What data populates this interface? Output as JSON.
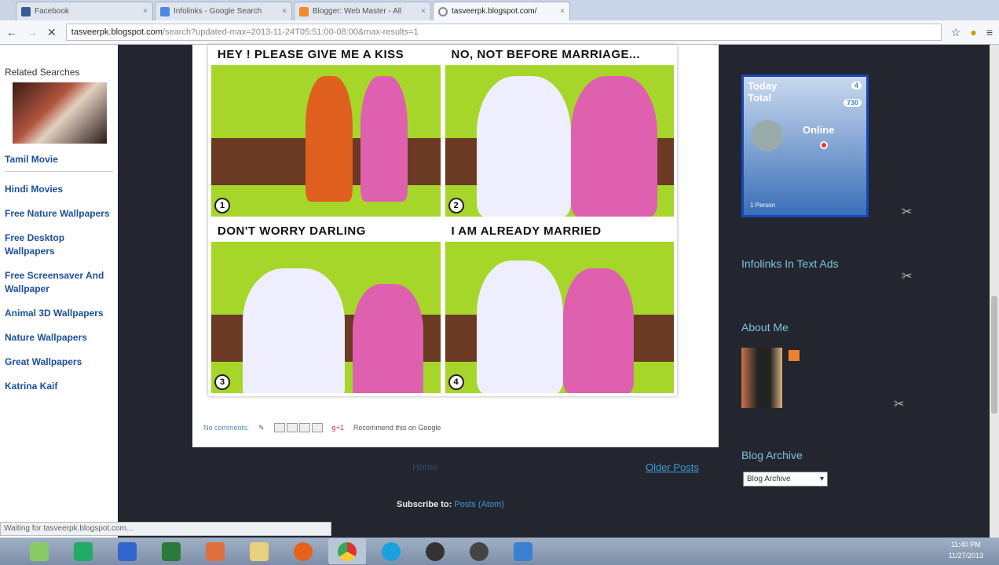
{
  "browser": {
    "tabs": [
      {
        "label": "Facebook",
        "color": "#3b5998"
      },
      {
        "label": "Infolinks - Google Search",
        "color": "#4a8ae0"
      },
      {
        "label": "Blogger: Web Master - All",
        "color": "#f28a2a"
      },
      {
        "label": "tasveerpk.blogspot.com/",
        "color": "#888"
      }
    ],
    "url_host": "tasveerpk.blogspot.com",
    "url_path": "/search?updated-max=2013-11-24T05:51:00-08:00&max-results=1"
  },
  "left": {
    "title": "Related Searches",
    "links": [
      "Tamil Movie",
      "Hindi Movies",
      "Free Nature Wallpapers",
      "Free Desktop Wallpapers",
      "Free Screensaver And Wallpaper",
      "Animal 3D Wallpapers",
      "Nature Wallpapers",
      "Great Wallpapers",
      "Katrina Kaif"
    ]
  },
  "comic": {
    "panels": [
      {
        "caption": "HEY ! PLEASE GIVE ME A KISS",
        "num": "1"
      },
      {
        "caption": "NO, NOT BEFORE MARRIAGE...",
        "num": "2"
      },
      {
        "caption": "DON'T WORRY DARLING",
        "num": "3"
      },
      {
        "caption": "I AM ALREADY MARRIED",
        "num": "4"
      }
    ]
  },
  "post": {
    "comments": "No comments:",
    "recommend": "Recommend this on Google"
  },
  "nav": {
    "newer": "Home",
    "older": "Older Posts",
    "subscribe": "Subscribe to:",
    "subscribe_link": "Posts (Atom)"
  },
  "sidebar": {
    "counter": {
      "today": "Today",
      "total": "Total",
      "today_val": "4",
      "total_val": "730",
      "online": "Online",
      "persons": "1 Person"
    },
    "infolinks": "Infolinks In Text Ads",
    "about": "About Me",
    "archive": "Blog Archive",
    "archive_select": "Blog Archive"
  },
  "status": "Waiting for tasveerpk.blogspot.com...",
  "clock": {
    "time": "11:40 PM",
    "date": "11/27/2013"
  }
}
